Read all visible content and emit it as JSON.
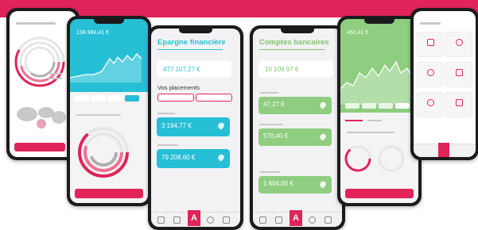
{
  "colors": {
    "brand_pink": "#e0245a",
    "teal": "#27bfd6",
    "green": "#8fcd80"
  },
  "epargne_screen": {
    "title": "Epargne financière",
    "total": "477 107,27 €",
    "section_title": "Vos placements",
    "cards": [
      "3 194,77 €",
      "79 208,60 €"
    ],
    "tabbar_logo": "A"
  },
  "comptes_screen": {
    "title": "Comptes bancaires",
    "total": "10 109,97 €",
    "cards": [
      "47,27 €",
      "570,40 €",
      "1 604,00 €"
    ],
    "tabbar_logo": "A"
  },
  "teal_screen": {
    "balance": "138 984,41 €"
  },
  "green_screen": {
    "balance": "452,41 €"
  },
  "icons": [
    "bank-icon",
    "wallet-icon",
    "chat-icon",
    "grid-icon",
    "heart-icon",
    "pie-chart-icon"
  ]
}
